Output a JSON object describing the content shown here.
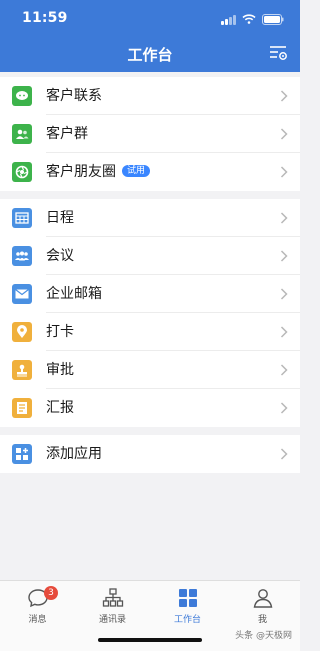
{
  "status_bar": {
    "time": "11:59"
  },
  "header": {
    "title": "工作台"
  },
  "customer_group": {
    "items": [
      {
        "label": "客户联系",
        "icon": "chat-bubble-icon",
        "color": "#3db34b"
      },
      {
        "label": "客户群",
        "icon": "group-people-icon",
        "color": "#3db34b"
      },
      {
        "label": "客户朋友圈",
        "icon": "aperture-icon",
        "color": "#3db34b",
        "badge": "试用"
      }
    ]
  },
  "office_group": {
    "items": [
      {
        "label": "日程",
        "icon": "calendar-grid-icon",
        "color": "#4a90e2"
      },
      {
        "label": "会议",
        "icon": "meeting-people-icon",
        "color": "#4a90e2"
      },
      {
        "label": "企业邮箱",
        "icon": "mail-icon",
        "color": "#4a90e2"
      },
      {
        "label": "打卡",
        "icon": "location-pin-icon",
        "color": "#f0b03c"
      },
      {
        "label": "审批",
        "icon": "stamp-icon",
        "color": "#f0b03c"
      },
      {
        "label": "汇报",
        "icon": "report-doc-icon",
        "color": "#f0b03c"
      }
    ]
  },
  "add_group": {
    "items": [
      {
        "label": "添加应用",
        "icon": "add-app-grid-icon",
        "color": "#4a90e2"
      }
    ]
  },
  "tabbar": {
    "tabs": [
      {
        "label": "消息",
        "icon": "message-bubble-icon",
        "badge": "3"
      },
      {
        "label": "通讯录",
        "icon": "org-chart-icon"
      },
      {
        "label": "工作台",
        "icon": "workbench-grid-icon",
        "active": true
      },
      {
        "label": "我",
        "icon": "person-icon"
      }
    ]
  },
  "watermark": "头条 @天极网",
  "colors": {
    "header": "#3d7ad8",
    "accent": "#3d7ad8",
    "badge_red": "#e64b3c"
  }
}
